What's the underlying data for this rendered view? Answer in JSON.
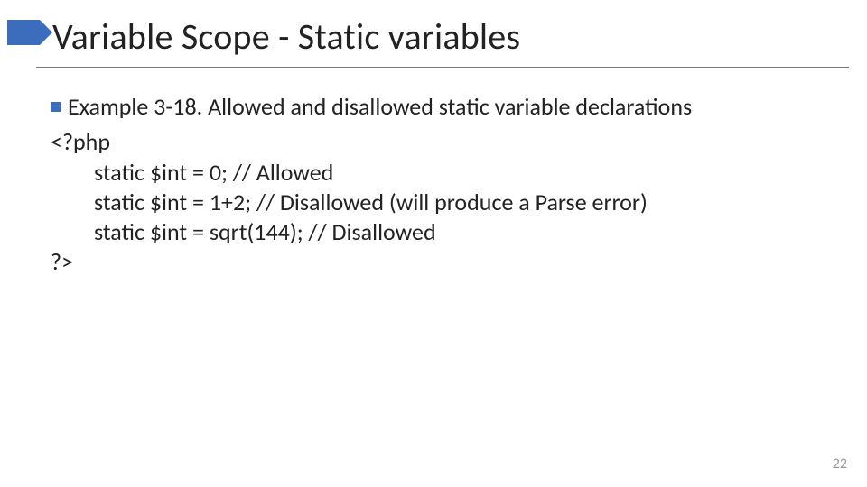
{
  "title": "Variable Scope - Static variables",
  "bullet": "Example 3-18. Allowed and disallowed static variable declarations",
  "code": {
    "open": "<?php",
    "l1": "static $int = 0; // Allowed",
    "l2": "static $int = 1+2; // Disallowed (will produce a Parse error)",
    "l3": "static $int = sqrt(144); // Disallowed",
    "close": "?>"
  },
  "pagenum": "22"
}
